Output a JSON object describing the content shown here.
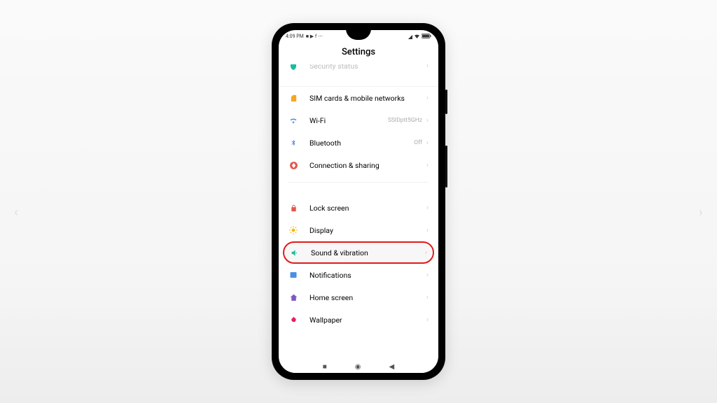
{
  "status": {
    "time": "4:09 PM",
    "icons": "■ ▶ f ⋯"
  },
  "header": {
    "title": "Settings"
  },
  "rows": {
    "security": {
      "label": "Security status"
    },
    "sim": {
      "label": "SIM cards & mobile networks"
    },
    "wifi": {
      "label": "Wi-Fi",
      "value": "SSIDptt5GHz"
    },
    "bt": {
      "label": "Bluetooth",
      "value": "Off"
    },
    "conn": {
      "label": "Connection & sharing"
    },
    "lock": {
      "label": "Lock screen"
    },
    "display": {
      "label": "Display"
    },
    "sound": {
      "label": "Sound & vibration"
    },
    "notif": {
      "label": "Notifications"
    },
    "home": {
      "label": "Home screen"
    },
    "wall": {
      "label": "Wallpaper"
    }
  }
}
